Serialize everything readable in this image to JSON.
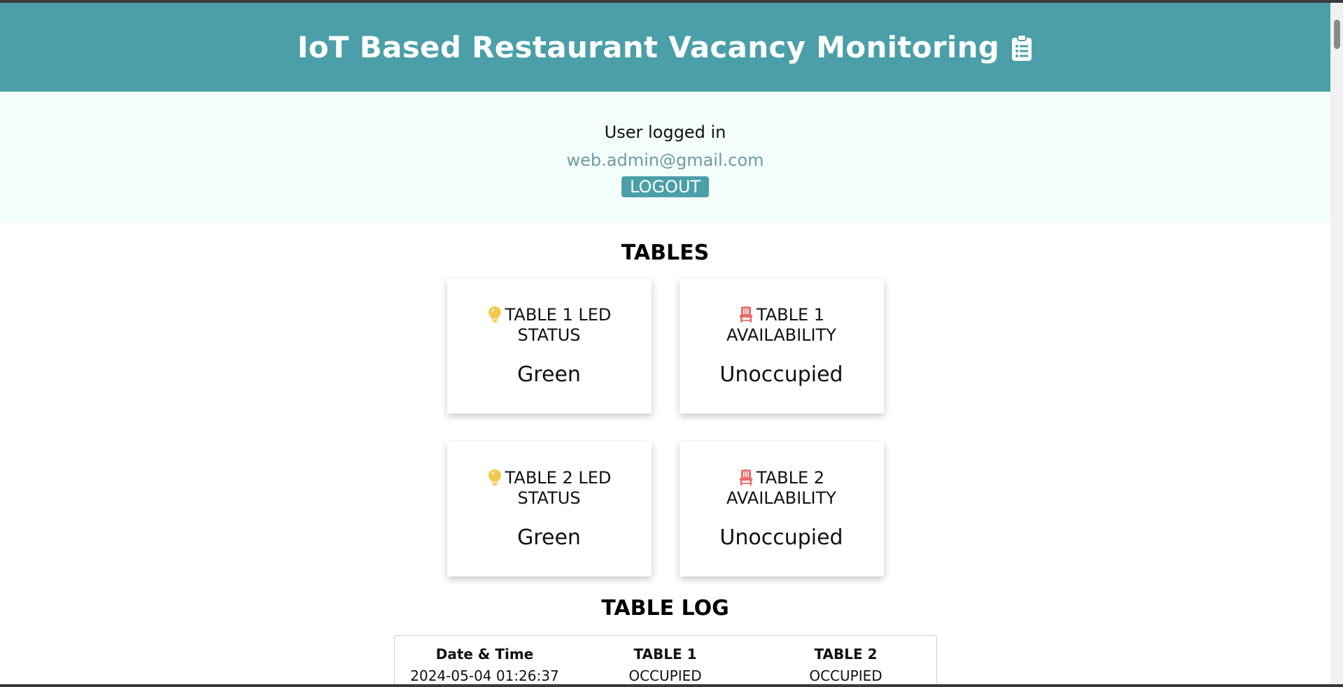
{
  "header": {
    "title": "IoT Based Restaurant Vacancy Monitoring",
    "icon": "clipboard-list-icon",
    "background": "#4a9fa8"
  },
  "auth": {
    "label": "User logged in",
    "email": "web.admin@gmail.com",
    "logout_label": "LOGOUT"
  },
  "tables_section": {
    "title": "TABLES",
    "cards": [
      {
        "icon": "lightbulb-icon",
        "title": "TABLE 1 LED STATUS",
        "value": "Green"
      },
      {
        "icon": "chair-icon",
        "title": "TABLE 1 AVAILABILITY",
        "value": "Unoccupied"
      },
      {
        "icon": "lightbulb-icon",
        "title": "TABLE 2 LED STATUS",
        "value": "Green"
      },
      {
        "icon": "chair-icon",
        "title": "TABLE 2 AVAILABILITY",
        "value": "Unoccupied"
      }
    ]
  },
  "log_section": {
    "title": "TABLE LOG",
    "columns": [
      "Date & Time",
      "TABLE 1",
      "TABLE 2"
    ],
    "rows": [
      [
        "2024-05-04 01:26:37",
        "OCCUPIED",
        "OCCUPIED"
      ]
    ]
  },
  "colors": {
    "accent": "#4a9fa8",
    "auth_background": "#f3fdf9",
    "email_text": "#6f9aa3",
    "bulb": "#f2c94c",
    "chair": "#e96a6a"
  }
}
